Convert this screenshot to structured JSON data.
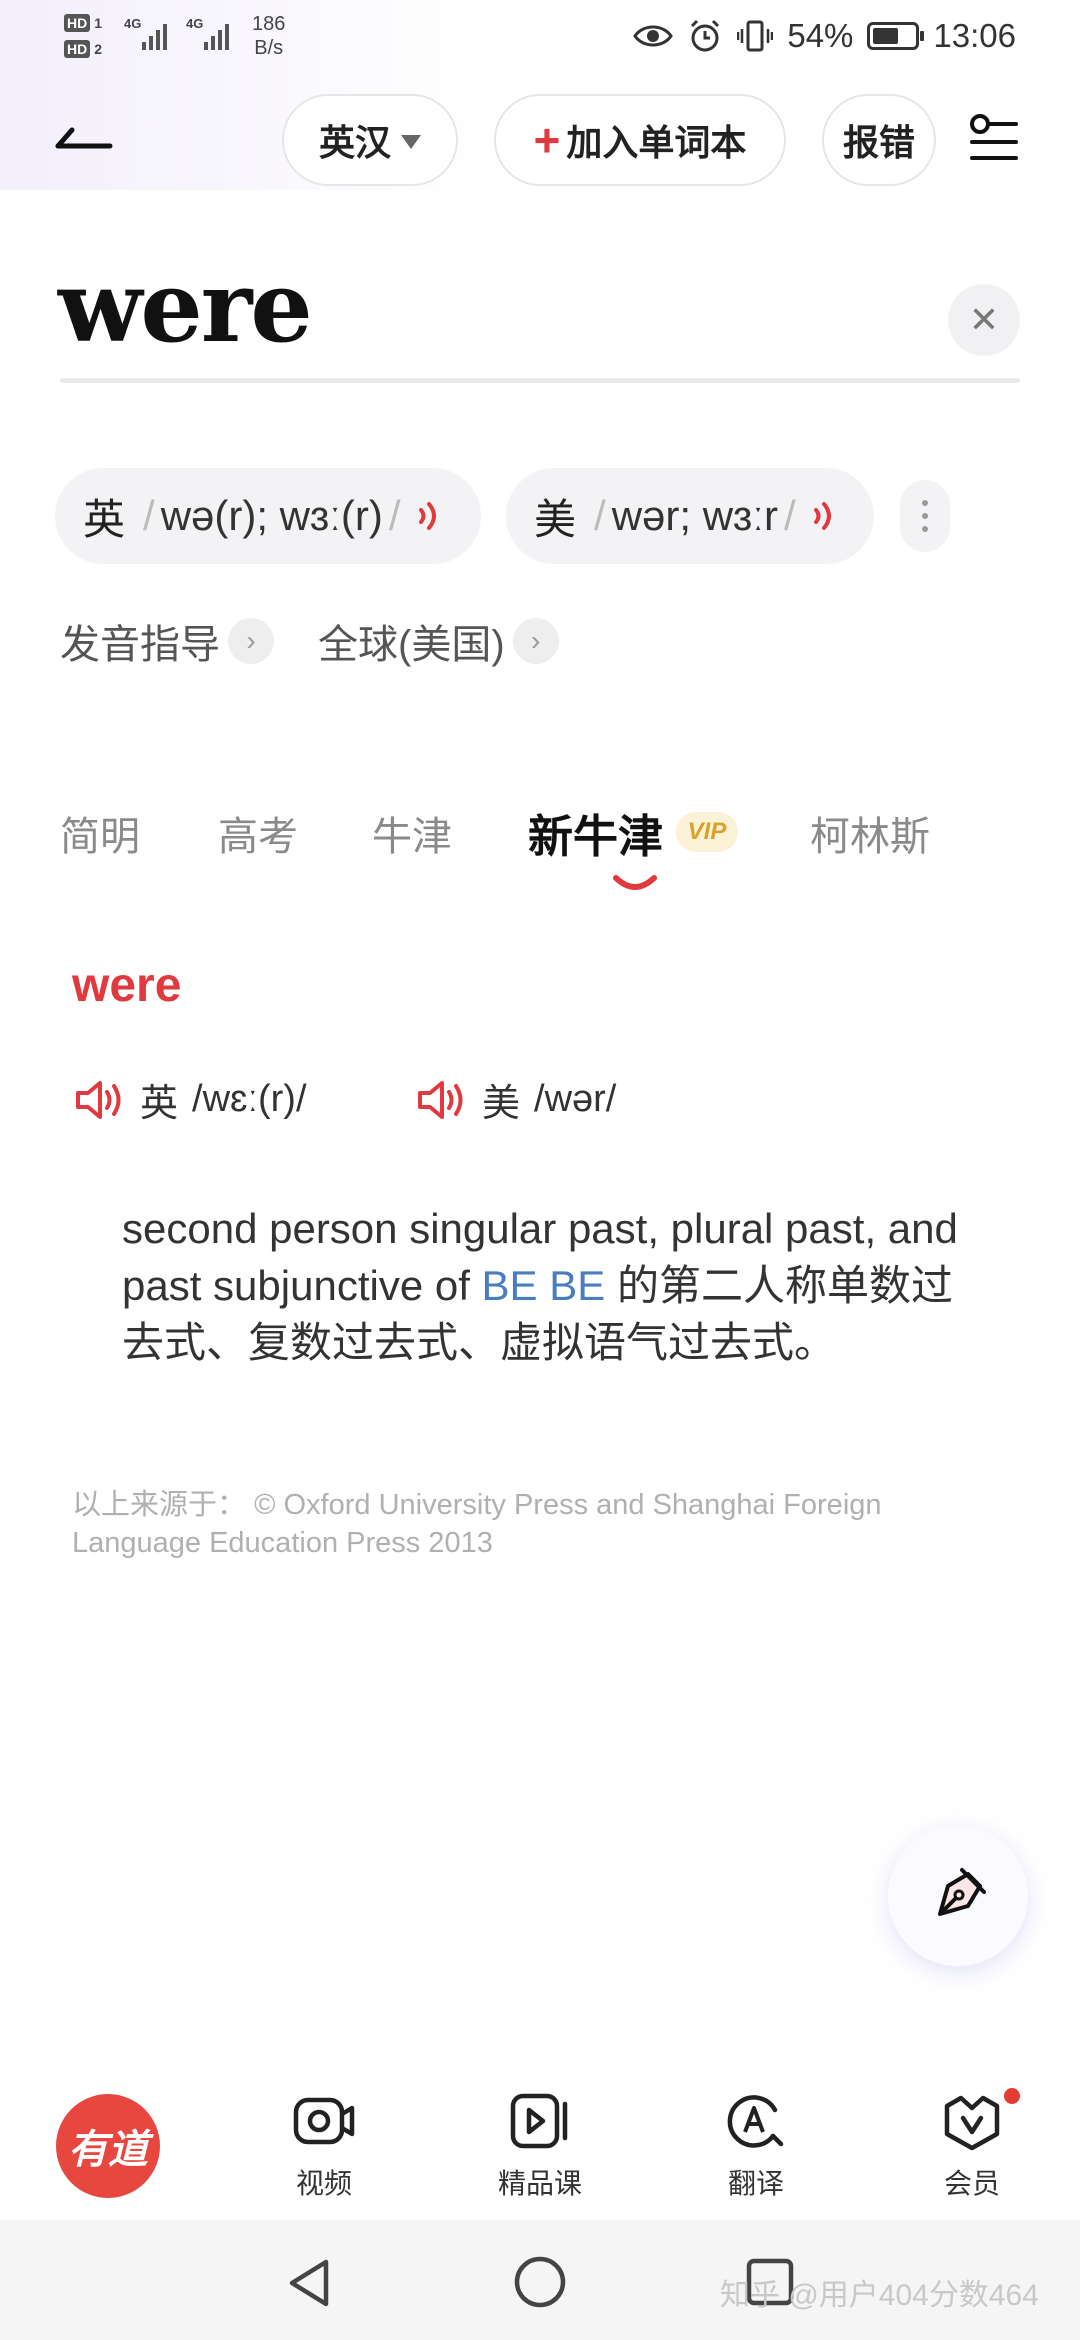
{
  "status_bar": {
    "sim1": "HD",
    "sim1_num": "1",
    "sim2": "HD",
    "sim2_num": "2",
    "net1": "4G",
    "net2": "4G",
    "speed_value": "186",
    "speed_unit": "B/s",
    "battery": "54%",
    "battery_level": 0.54,
    "time": "13:06"
  },
  "header": {
    "lang_label": "英汉",
    "add_label": "加入单词本",
    "report_label": "报错"
  },
  "search": {
    "word": "were"
  },
  "pronunciations": {
    "uk_label": "英",
    "uk_ipa": "wə(r); wɜː(r)",
    "us_label": "美",
    "us_ipa": "wər; wɜːr"
  },
  "guide_links": [
    {
      "label": "发音指导"
    },
    {
      "label": "全球(美国)"
    }
  ],
  "tabs": [
    {
      "label": "简明"
    },
    {
      "label": "高考"
    },
    {
      "label": "牛津"
    },
    {
      "label": "新牛津",
      "badge": "VIP"
    },
    {
      "label": "柯林斯"
    }
  ],
  "entry": {
    "headword": "were",
    "uk_label": "英",
    "uk_ipa": "/wɛː(r)/",
    "us_label": "美",
    "us_ipa": "/wər/",
    "definition_pre": "second person singular past, plural past, and past subjunctive of ",
    "definition_xref": "BE BE",
    "definition_post": " 的第二人称单数过去式、复数过去式、虚拟语气过去式。",
    "source_label": "以上来源于：",
    "source_text": "© Oxford University Press and Shanghai Foreign Language Education Press 2013"
  },
  "bottom_nav": {
    "logo_text": "有道",
    "items": [
      {
        "label": "视频",
        "icon": "video-camera-icon"
      },
      {
        "label": "精品课",
        "icon": "course-play-icon"
      },
      {
        "label": "翻译",
        "icon": "translate-icon"
      },
      {
        "label": "会员",
        "icon": "vip-crown-icon"
      }
    ]
  },
  "watermark": "知乎 @用户404分数464",
  "colors": {
    "accent_red": "#e0393e",
    "link_blue": "#4a7dbf",
    "vip_gold": "#d8a32a",
    "logo_red": "#e8473f"
  }
}
